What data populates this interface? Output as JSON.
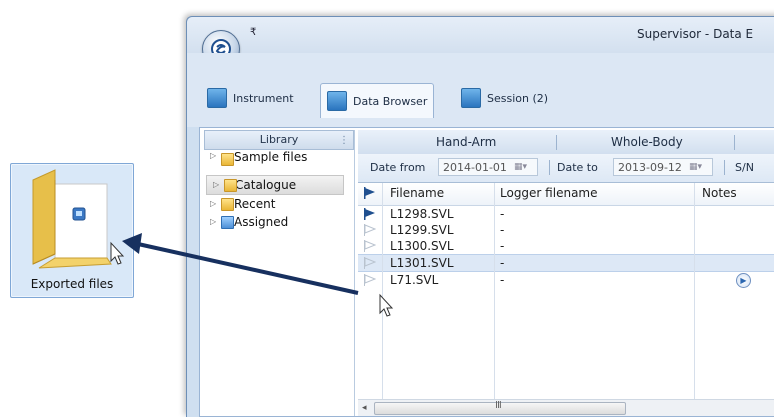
{
  "desktop": {
    "folder_label": "Exported files"
  },
  "window": {
    "qat_glyph": "₹",
    "title": "Supervisor - Data E"
  },
  "tabs": [
    {
      "label": "Instrument",
      "icon": "instrument-icon"
    },
    {
      "label": "Data Browser",
      "icon": "binoculars-icon"
    },
    {
      "label": "Session (2)",
      "icon": "session-icon"
    }
  ],
  "sidebar": {
    "header": "Library",
    "items": [
      {
        "label": "Sample files",
        "icon": "folder-icon"
      },
      {
        "label": "Catalogue",
        "icon": "folder-icon"
      },
      {
        "label": "Recent",
        "icon": "recent-folder-icon"
      },
      {
        "label": "Assigned",
        "icon": "assigned-folder-icon"
      }
    ]
  },
  "filter_tabs": [
    "Hand-Arm",
    "Whole-Body"
  ],
  "filters": {
    "date_from_label": "Date from",
    "date_from_value": "2014-01-01",
    "date_to_label": "Date to",
    "date_to_value": "2013-09-12",
    "sn_label": "S/N"
  },
  "grid": {
    "columns": [
      "Filename",
      "Logger filename",
      "Notes"
    ],
    "rows": [
      {
        "filename": "L1298.SVL",
        "logger": "-",
        "flag": "filled",
        "note": false
      },
      {
        "filename": "L1299.SVL",
        "logger": "-",
        "flag": "outline",
        "note": false
      },
      {
        "filename": "L1300.SVL",
        "logger": "-",
        "flag": "outline",
        "note": false
      },
      {
        "filename": "L1301.SVL",
        "logger": "-",
        "flag": "outline",
        "note": false,
        "highlighted": true
      },
      {
        "filename": "L71.SVL",
        "logger": "-",
        "flag": "outline",
        "note": true
      }
    ],
    "scroll_grip": "III"
  },
  "colors": {
    "accent": "#1f4f8f",
    "arrow": "#17305f",
    "selection": "#dde8f6"
  }
}
